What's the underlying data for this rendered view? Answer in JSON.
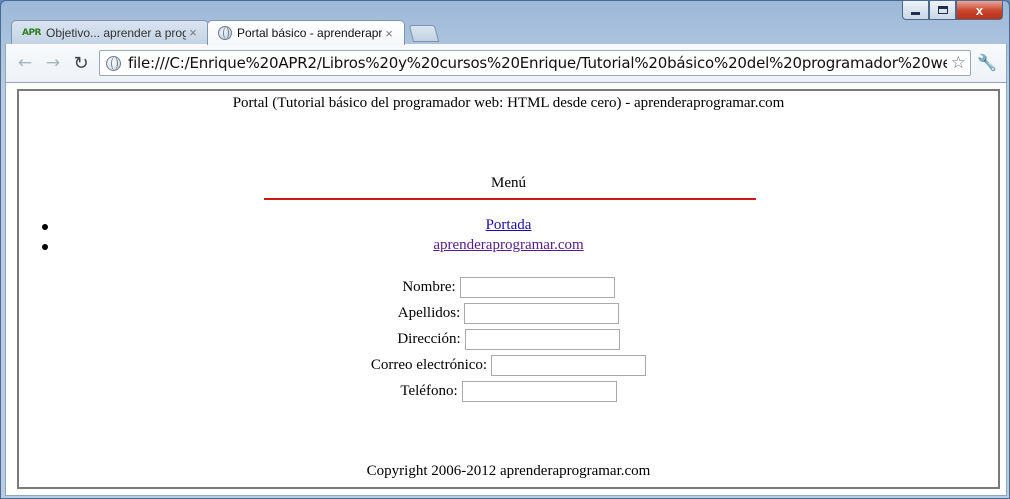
{
  "tabs": [
    {
      "title": "Objetivo... aprender a progr",
      "favicon": "APR",
      "active": false
    },
    {
      "title": "Portal básico - aprenderapr",
      "favicon": "globe-icon",
      "active": true
    }
  ],
  "window_controls": {
    "close": "x"
  },
  "toolbar": {
    "url": "file:///C:/Enrique%20APR2/Libros%20y%20cursos%20Enrique/Tutorial%20básico%20del%20programador%20web%20HTML%20d",
    "back_glyph": "←",
    "forward_glyph": "→",
    "reload_glyph": "↻",
    "star_glyph": "☆",
    "wrench_glyph": "🔧"
  },
  "page": {
    "title": "Portal (Tutorial básico del programador web: HTML desde cero) - aprenderaprogramar.com",
    "menu_heading": "Menú",
    "menu_items": [
      {
        "label": "Portada"
      },
      {
        "label": "aprenderaprogramar.com"
      }
    ],
    "form_fields": [
      {
        "label": "Nombre:",
        "value": ""
      },
      {
        "label": "Apellidos:",
        "value": ""
      },
      {
        "label": "Dirección:",
        "value": ""
      },
      {
        "label": "Correo electrónico:",
        "value": ""
      },
      {
        "label": "Teléfono:",
        "value": ""
      }
    ],
    "footer": "Copyright 2006-2012 aprenderaprogramar.com"
  },
  "colors": {
    "menu_rule": "#cc1a12",
    "link": "#1a0dab",
    "visited_link": "#551a8b"
  }
}
